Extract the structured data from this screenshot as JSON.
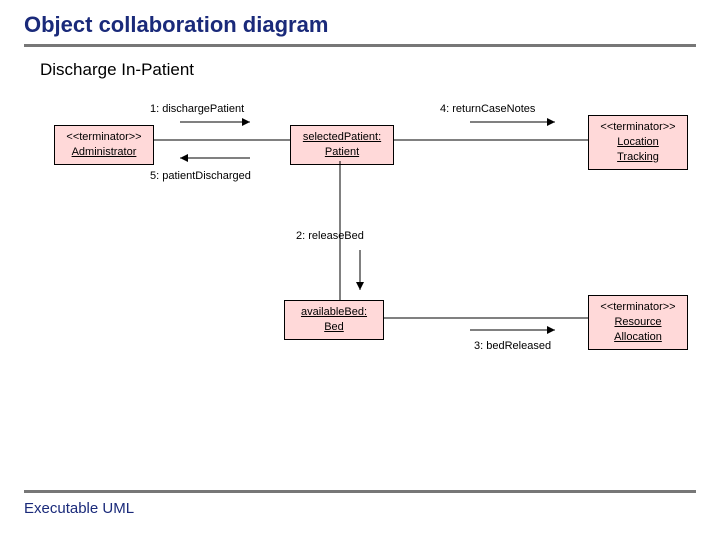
{
  "title": "Object collaboration diagram",
  "subtitle": "Discharge In-Patient",
  "footer": "Executable UML",
  "nodes": {
    "administrator": {
      "stereotype": "<<terminator>>",
      "name": "Administrator"
    },
    "patient": {
      "label": "selectedPatient:",
      "type": "Patient"
    },
    "location": {
      "stereotype": "<<terminator>>",
      "name": "Location Tracking"
    },
    "bed": {
      "label": "availableBed:",
      "type": "Bed"
    },
    "resource": {
      "stereotype": "<<terminator>>",
      "name": "Resource Allocation"
    }
  },
  "messages": {
    "m1": "1: dischargePatient",
    "m2": "2: releaseBed",
    "m3": "3: bedReleased",
    "m4": "4: returnCaseNotes",
    "m5": "5: patientDischarged"
  }
}
